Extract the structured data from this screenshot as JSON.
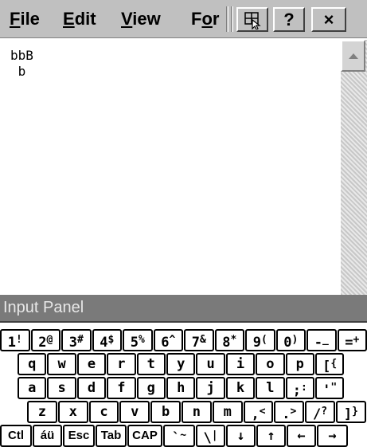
{
  "menu": [
    {
      "pre": "",
      "u": "F",
      "post": "ile"
    },
    {
      "pre": "",
      "u": "E",
      "post": "dit"
    },
    {
      "pre": "",
      "u": "V",
      "post": "iew"
    },
    {
      "pre": "F",
      "u": "o",
      "post": "r"
    }
  ],
  "toolbar": {
    "help_label": "?",
    "close_label": "×"
  },
  "editor": {
    "lines": [
      "bbB",
      " b"
    ]
  },
  "input_panel": {
    "title": "Input Panel"
  },
  "keyboard": {
    "rows": [
      [
        [
          "1",
          "!"
        ],
        [
          "2",
          "@"
        ],
        [
          "3",
          "#"
        ],
        [
          "4",
          "$"
        ],
        [
          "5",
          "%"
        ],
        [
          "6",
          "^"
        ],
        [
          "7",
          "&"
        ],
        [
          "8",
          "*"
        ],
        [
          "9",
          "("
        ],
        [
          "0",
          ")"
        ],
        [
          "-",
          "_"
        ],
        [
          "=",
          "+"
        ]
      ],
      [
        [
          "q",
          ""
        ],
        [
          "w",
          ""
        ],
        [
          "e",
          ""
        ],
        [
          "r",
          ""
        ],
        [
          "t",
          ""
        ],
        [
          "y",
          ""
        ],
        [
          "u",
          ""
        ],
        [
          "i",
          ""
        ],
        [
          "o",
          ""
        ],
        [
          "p",
          ""
        ],
        [
          "[",
          "{"
        ]
      ],
      [
        [
          "a",
          ""
        ],
        [
          "s",
          ""
        ],
        [
          "d",
          ""
        ],
        [
          "f",
          ""
        ],
        [
          "g",
          ""
        ],
        [
          "h",
          ""
        ],
        [
          "j",
          ""
        ],
        [
          "k",
          ""
        ],
        [
          "l",
          ""
        ],
        [
          ";",
          ":"
        ],
        [
          "'",
          "\""
        ]
      ],
      [
        [
          "z",
          ""
        ],
        [
          "x",
          ""
        ],
        [
          "c",
          ""
        ],
        [
          "v",
          ""
        ],
        [
          "b",
          ""
        ],
        [
          "n",
          ""
        ],
        [
          "m",
          ""
        ],
        [
          ",",
          "<"
        ],
        [
          ".",
          ">"
        ],
        [
          "/",
          "?"
        ],
        [
          "]",
          "}"
        ]
      ],
      [
        [
          "Ctl",
          ""
        ],
        [
          "áü",
          ""
        ],
        [
          "Esc",
          ""
        ],
        [
          "Tab",
          ""
        ],
        [
          "CAP",
          ""
        ],
        [
          "`",
          "~"
        ],
        [
          "\\",
          "|"
        ],
        [
          "↓",
          ""
        ],
        [
          "↑",
          ""
        ],
        [
          "←",
          ""
        ],
        [
          "→",
          ""
        ]
      ]
    ]
  }
}
